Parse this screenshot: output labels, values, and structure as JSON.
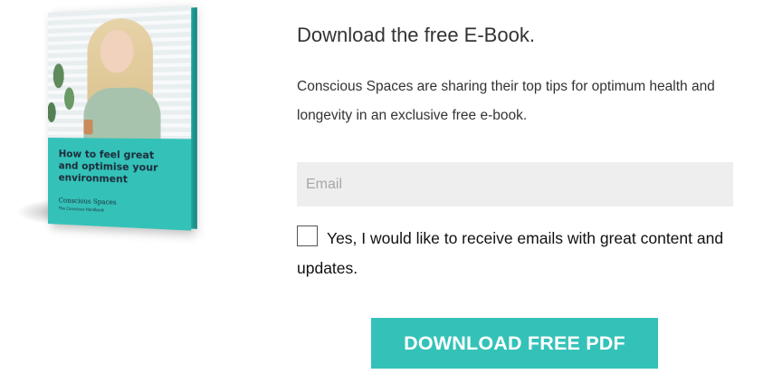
{
  "ebook": {
    "cover_title": "How to feel great and optimise your environment",
    "cover_brand": "Conscious Spaces",
    "cover_tagline": "The Conscious Handbook"
  },
  "form": {
    "heading": "Download the free E-Book.",
    "description": "Conscious Spaces are sharing their top tips for optimum health and longevity in an exclusive free e-book.",
    "email_placeholder": "Email",
    "email_value": "",
    "consent_checked": false,
    "consent_label": "Yes, I would like to receive emails with great content and updates.",
    "submit_label": "DOWNLOAD FREE PDF"
  },
  "colors": {
    "accent": "#34c2b8",
    "input_bg": "#eeeeee",
    "text": "#333333"
  }
}
